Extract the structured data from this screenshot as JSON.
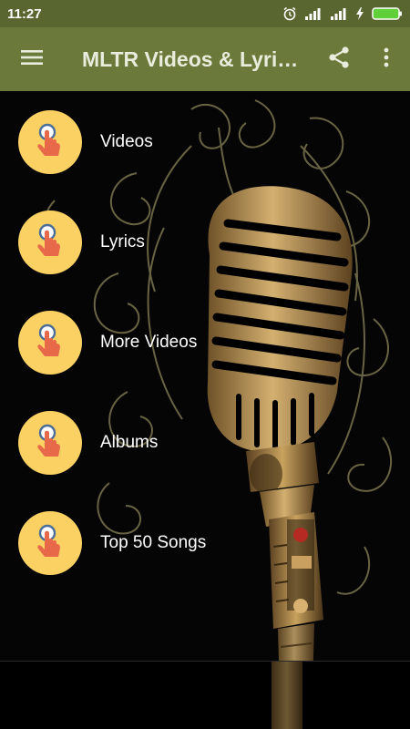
{
  "status": {
    "time": "11:27"
  },
  "appbar": {
    "title": "MLTR Videos & Lyri…",
    "icons": [
      "hamburger-menu-icon",
      "share-icon",
      "more-vert-icon"
    ]
  },
  "menu": {
    "items": [
      {
        "label": "Videos",
        "icon": "tap-finger-icon"
      },
      {
        "label": "Lyrics",
        "icon": "tap-finger-icon"
      },
      {
        "label": "More Videos",
        "icon": "tap-finger-icon"
      },
      {
        "label": "Albums",
        "icon": "tap-finger-icon"
      },
      {
        "label": "Top 50 Songs",
        "icon": "tap-finger-icon"
      }
    ]
  },
  "colors": {
    "status_bar": "#5a6630",
    "app_bar": "#6b7a3a",
    "icon_circle": "#fbd163",
    "finger": "#e8684a",
    "microphone_gold": "#b8914a"
  }
}
